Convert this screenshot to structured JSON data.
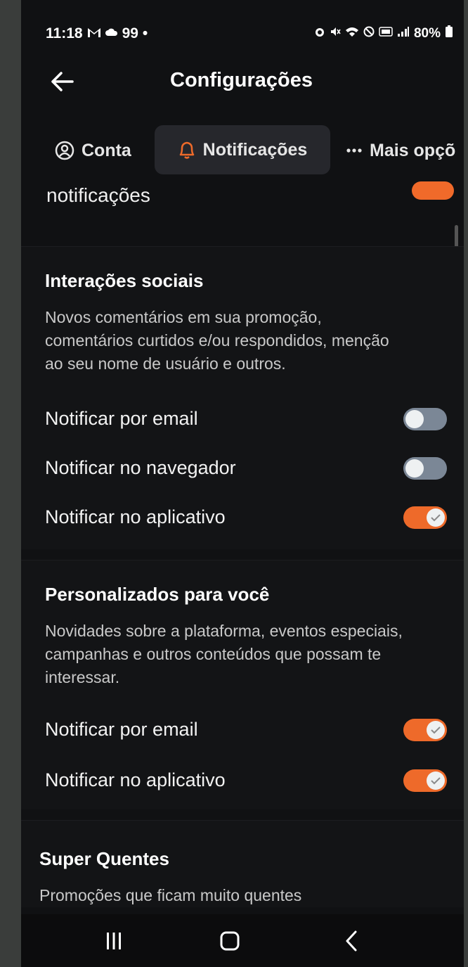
{
  "status": {
    "time": "11:18",
    "left_icons": [
      "gmail-icon",
      "cloud-icon"
    ],
    "notification_count": "99",
    "dot": "•",
    "battery": "80%",
    "right_icons": [
      "alarm-icon",
      "mute-icon",
      "wifi-icon",
      "blocked-icon",
      "volte-icon",
      "signal-icon",
      "battery-icon"
    ]
  },
  "appbar": {
    "title": "Configurações"
  },
  "tabs": [
    {
      "label": "Conta",
      "icon": "user-circle-icon"
    },
    {
      "label": "Notificações",
      "icon": "bell-icon",
      "active": true
    },
    {
      "label": "Mais opçõ",
      "icon": "more-dots-icon"
    }
  ],
  "partial": {
    "heading": "notificações"
  },
  "sections": {
    "social": {
      "title": "Interações sociais",
      "description": "Novos comentários em sua promoção, comentários curtidos e/ou respondidos, menção ao seu nome de usuário e outros.",
      "rows": [
        {
          "label": "Notificar por email",
          "on": false
        },
        {
          "label": "Notificar no navegador",
          "on": false
        },
        {
          "label": "Notificar no aplicativo",
          "on": true
        }
      ]
    },
    "personal": {
      "title": "Personalizados para você",
      "description": "Novidades sobre a plataforma, eventos especiais, campanhas e outros conteúdos que possam te interessar.",
      "rows": [
        {
          "label": "Notificar por email",
          "on": true
        },
        {
          "label": "Notificar no aplicativo",
          "on": true
        }
      ]
    },
    "hot": {
      "title": "Super Quentes",
      "description": "Promoções que ficam muito quentes"
    }
  },
  "colors": {
    "accent": "#ee6a2a",
    "background": "#101113",
    "toggle_off": "#7b8796"
  }
}
